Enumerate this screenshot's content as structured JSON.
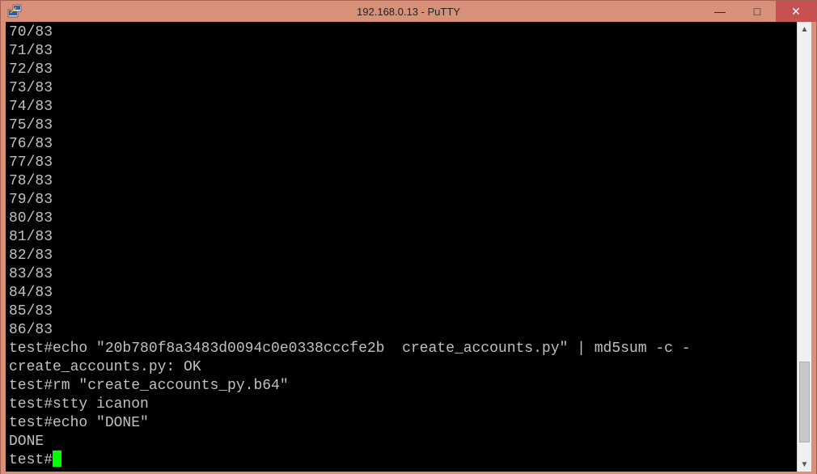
{
  "window": {
    "title": "192.168.0.13 - PuTTY"
  },
  "terminal": {
    "lines": [
      "70/83",
      "71/83",
      "72/83",
      "73/83",
      "74/83",
      "75/83",
      "76/83",
      "77/83",
      "78/83",
      "79/83",
      "80/83",
      "81/83",
      "82/83",
      "83/83",
      "84/83",
      "85/83",
      "86/83",
      "test#echo \"20b780f8a3483d0094c0e0338cccfe2b  create_accounts.py\" | md5sum -c -",
      "create_accounts.py: OK",
      "test#rm \"create_accounts_py.b64\"",
      "test#stty icanon",
      "test#echo \"DONE\"",
      "DONE"
    ],
    "prompt": "test#"
  },
  "icons": {
    "minimize": "—",
    "maximize": "□",
    "close": "✕",
    "scroll_up": "▲",
    "scroll_down": "▼"
  }
}
